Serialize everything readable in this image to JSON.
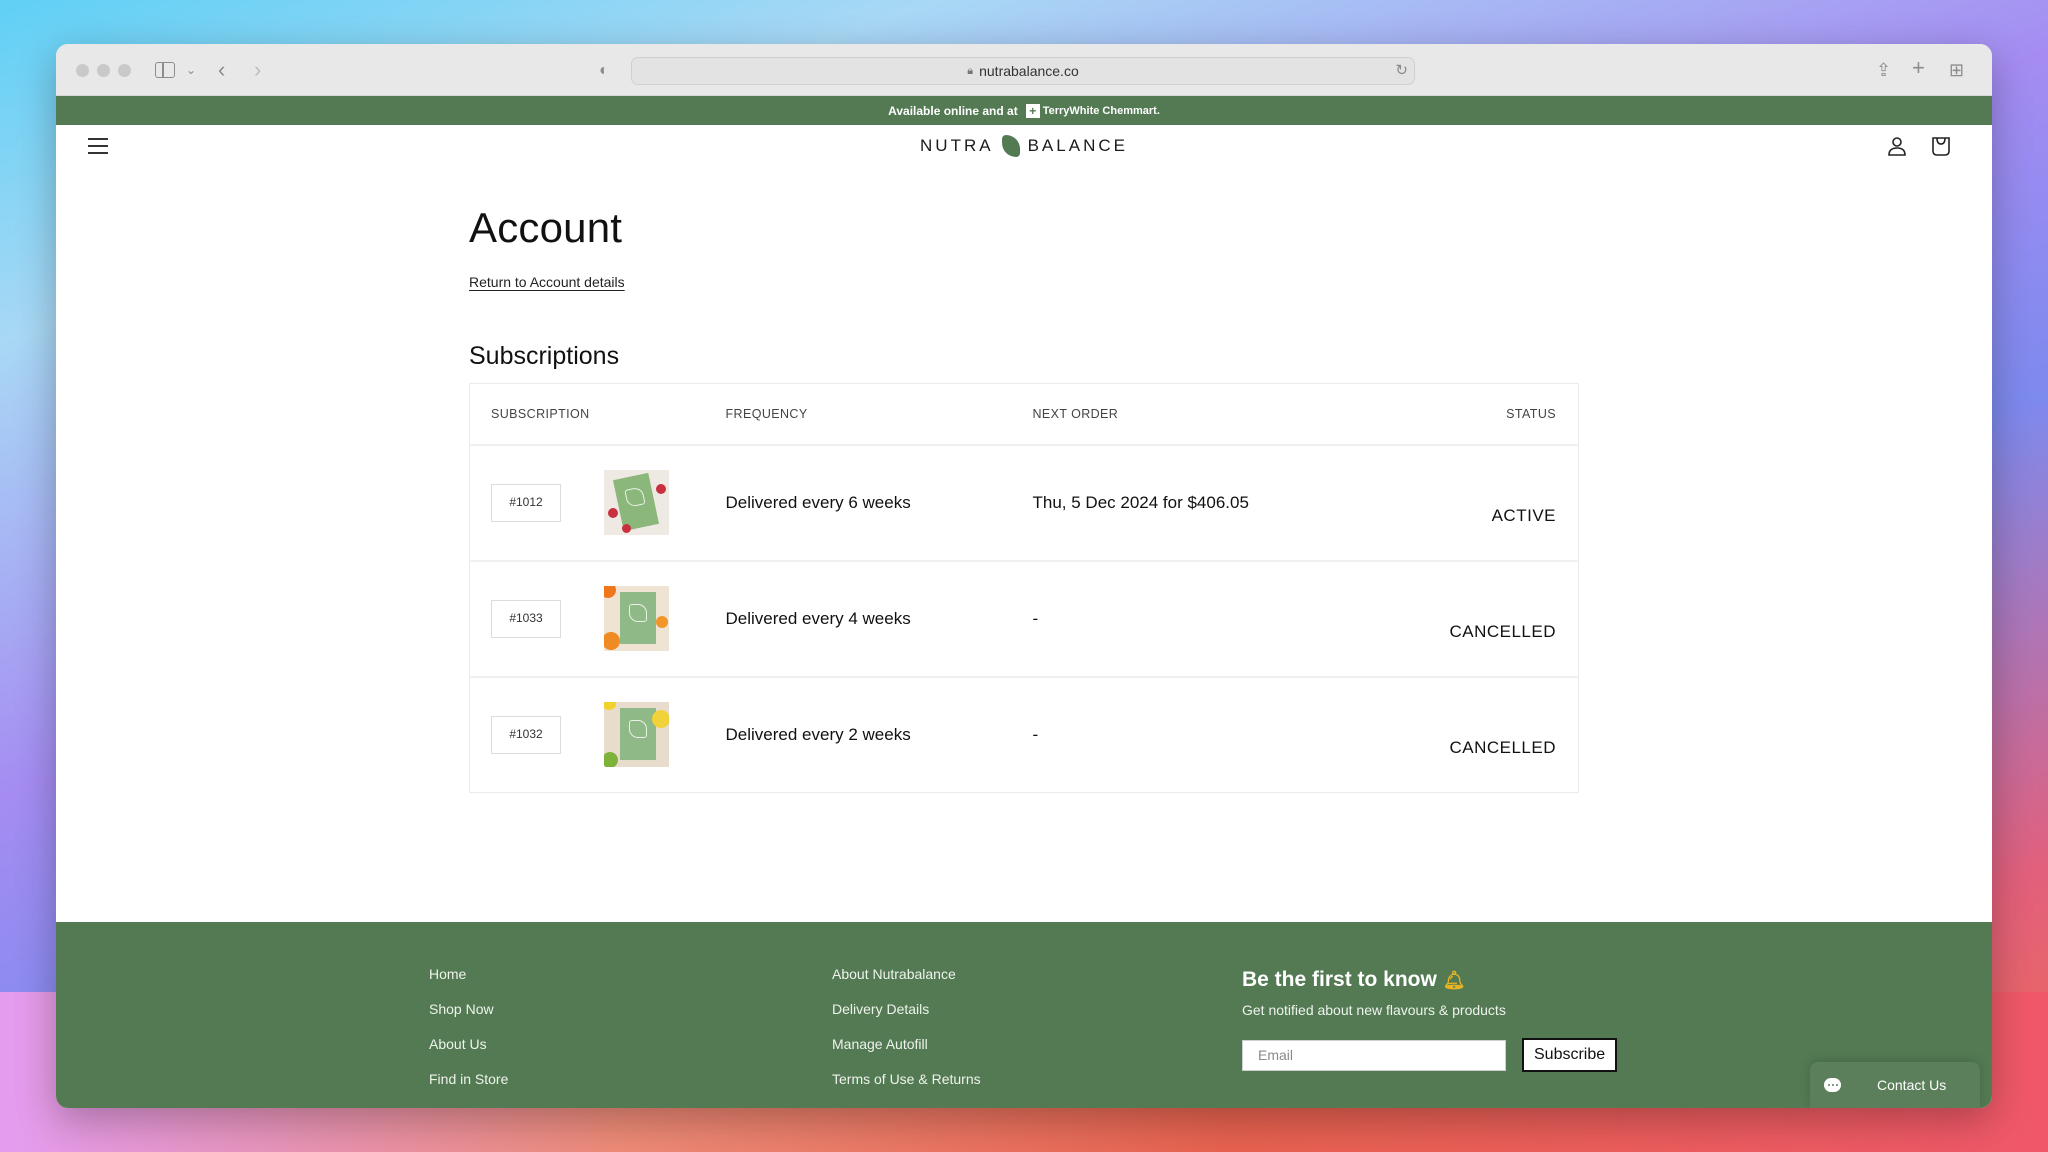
{
  "browser": {
    "url": "nutrabalance.co",
    "icons": {
      "sidebar": "sidebar-icon",
      "back": "chevron-left-icon",
      "forward": "chevron-right-icon",
      "privacy": "shield-icon",
      "lock": "lock-icon",
      "reload": "reload-icon",
      "share": "share-icon",
      "new_tab": "plus-icon",
      "tab_overview": "grid-icon"
    }
  },
  "announcement": {
    "text": "Available online and at",
    "partner": "TerryWhite Chemmart."
  },
  "header": {
    "logo_left": "NUTRA",
    "logo_right": "BALANCE",
    "icons": {
      "menu": "hamburger-icon",
      "account": "user-icon",
      "cart": "bag-icon"
    }
  },
  "main": {
    "title": "Account",
    "return_link": "Return to Account details",
    "section_title": "Subscriptions",
    "table": {
      "headers": [
        "SUBSCRIPTION",
        "FREQUENCY",
        "NEXT ORDER",
        "STATUS"
      ],
      "rows": [
        {
          "id": "#1012",
          "product_image": "raspberry flavour pack",
          "frequency": "Delivered every 6 weeks",
          "next_order": "Thu, 5 Dec 2024 for $406.05",
          "status": "ACTIVE"
        },
        {
          "id": "#1033",
          "product_image": "orange flavour pack",
          "frequency": "Delivered every 4 weeks",
          "next_order": "-",
          "status": "CANCELLED"
        },
        {
          "id": "#1032",
          "product_image": "lemon lime flavour pack",
          "frequency": "Delivered every 2 weeks",
          "next_order": "-",
          "status": "CANCELLED"
        }
      ]
    }
  },
  "footer": {
    "links_col1": [
      "Home",
      "Shop Now",
      "About Us",
      "Find in Store"
    ],
    "links_col2": [
      "About Nutrabalance",
      "Delivery Details",
      "Manage Autofill",
      "Terms of Use & Returns"
    ],
    "newsletter": {
      "title": "Be the first to know",
      "title_icon": "bell-icon",
      "subtitle": "Get notified about new flavours & products",
      "email_placeholder": "Email",
      "email_value": "",
      "button": "Subscribe"
    },
    "contact": {
      "label": "Contact Us",
      "icon": "chat-icon"
    }
  },
  "colors": {
    "brand_green": "#537a53",
    "text_dark": "#111111"
  }
}
